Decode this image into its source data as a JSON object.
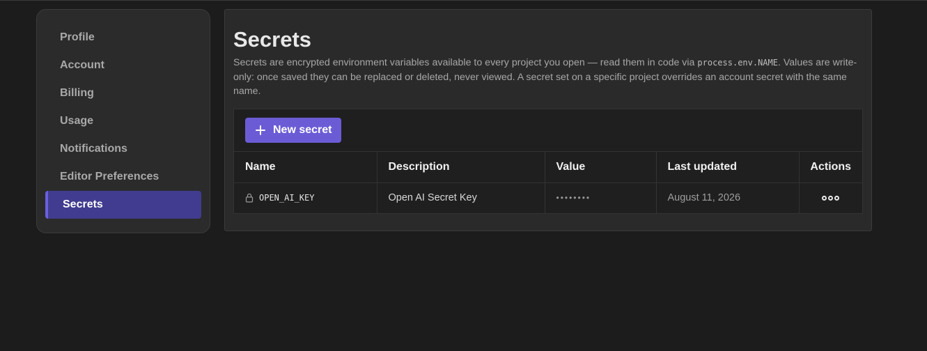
{
  "sidebar": {
    "items": [
      {
        "label": "Profile"
      },
      {
        "label": "Account"
      },
      {
        "label": "Billing"
      },
      {
        "label": "Usage"
      },
      {
        "label": "Notifications"
      },
      {
        "label": "Editor Preferences"
      },
      {
        "label": "Secrets",
        "active": true
      }
    ]
  },
  "main": {
    "title": "Secrets",
    "description_part1": "Secrets are encrypted environment variables available to every project you open — read them in code via ",
    "description_code": "process.env.NAME",
    "description_part2": ". Values are write-only: once saved they can be replaced or deleted, never viewed. A secret set on a specific project overrides an account secret with the same name.",
    "new_secret_label": "New secret",
    "columns": [
      "Name",
      "Description",
      "Value",
      "Last updated",
      "Actions"
    ],
    "rows": [
      {
        "name": "OPEN_AI_KEY",
        "description": "Open AI Secret Key",
        "value": "••••••••",
        "last_updated": "August 11, 2026"
      }
    ]
  },
  "colors": {
    "accent": "#6b5cd6",
    "active_nav": "#413c8f",
    "background": "#1c1c1c"
  },
  "icons": [
    "plus-icon",
    "lock-icon",
    "more-actions-icon"
  ]
}
